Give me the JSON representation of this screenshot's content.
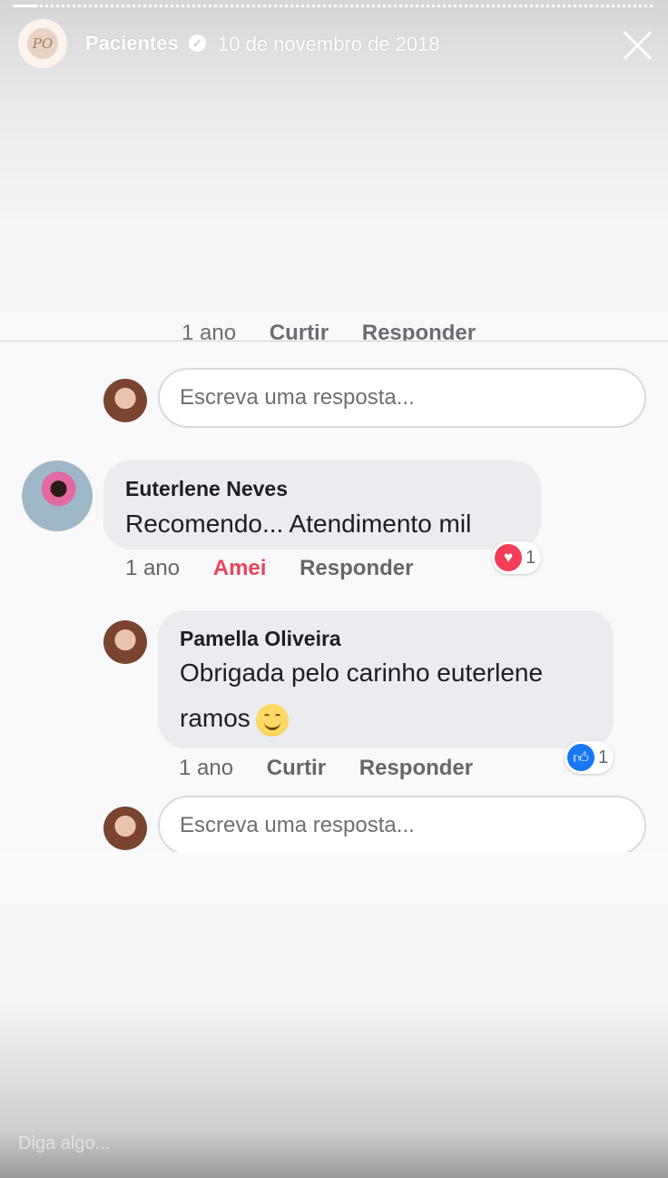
{
  "story": {
    "progress_fraction": 0.04,
    "account_name": "Pacientes",
    "date": "10 de novembro de 2018",
    "avatar_initials": "PO",
    "message_placeholder": "Diga algo..."
  },
  "screenshot": {
    "cut_actions": {
      "time": "1 ano",
      "like": "Curtir",
      "reply": "Responder"
    },
    "reply_input_1": "Escreva uma resposta...",
    "comment": {
      "author": "Euterlene Neves",
      "text": "Recomendo... Atendimento mil",
      "time": "1 ano",
      "reaction_label": "Amei",
      "reply_label": "Responder",
      "reaction_icon": "heart-icon",
      "reaction_count": "1"
    },
    "reply": {
      "author": "Pamella Oliveira",
      "text_line1": "Obrigada pelo carinho euterlene",
      "text_line2": "ramos",
      "emoji": "smiling-face-emoji",
      "time": "1 ano",
      "like_label": "Curtir",
      "reply_label": "Responder",
      "reaction_icon": "like-icon",
      "reaction_count": "1"
    },
    "reply_input_2": "Escreva uma resposta..."
  },
  "colors": {
    "loved": "#e8445c",
    "heart": "#f33e58",
    "like": "#1877f2",
    "bubble": "#ebecef"
  }
}
